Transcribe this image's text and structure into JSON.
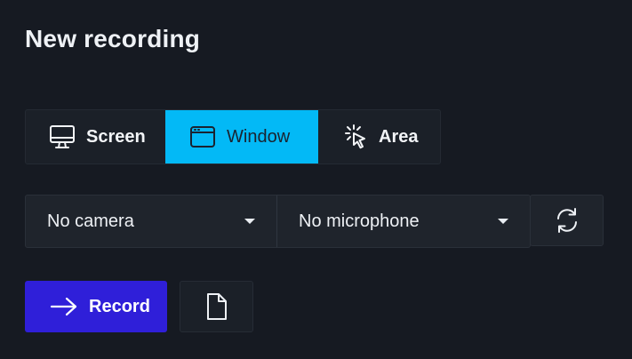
{
  "header": {
    "title": "New recording"
  },
  "sources": {
    "selected": "Window",
    "items": [
      {
        "label": "Screen",
        "icon": "monitor-icon"
      },
      {
        "label": "Window",
        "icon": "window-icon"
      },
      {
        "label": "Area",
        "icon": "cursor-click-icon"
      }
    ]
  },
  "devices": {
    "camera": {
      "value": "No camera"
    },
    "microphone": {
      "value": "No microphone"
    },
    "refresh_icon": "refresh-icon"
  },
  "actions": {
    "record_label": "Record",
    "record_icon": "arrow-right-icon",
    "file_icon": "file-icon"
  },
  "colors": {
    "background": "#161a22",
    "accent_selected": "#03b9f6",
    "record_button": "#2f1fd9"
  }
}
